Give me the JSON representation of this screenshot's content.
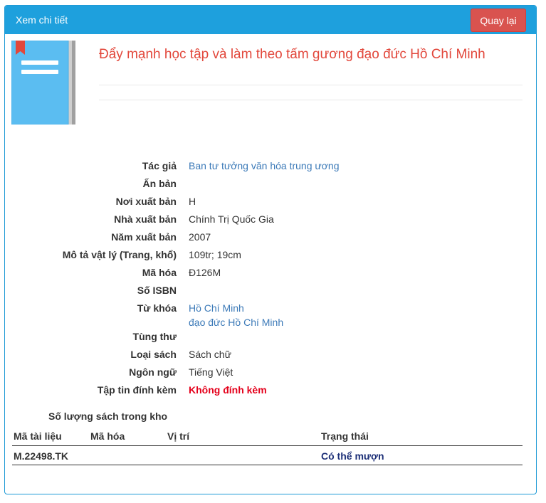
{
  "header": {
    "title": "Xem chi tiết",
    "back_label": "Quay lại"
  },
  "book": {
    "title": "Đẩy mạnh học tập và làm theo tấm gương đạo đức Hồ Chí Minh",
    "fields": {
      "author_label": "Tác giả",
      "author": "Ban tư tưởng văn hóa trung ương",
      "edition_label": "Ấn bản",
      "edition": "",
      "place_label": "Nơi xuất bản",
      "place": "H",
      "publisher_label": "Nhà xuất bản",
      "publisher": "Chính Trị Quốc Gia",
      "year_label": "Năm xuất bản",
      "year": "2007",
      "physical_label": "Mô tả vật lý (Trang, khổ)",
      "physical": "109tr; 19cm",
      "code_label": "Mã hóa",
      "code": "Đ126M",
      "isbn_label": "Số ISBN",
      "isbn": "",
      "keywords_label": "Từ khóa",
      "keywords": [
        "Hồ Chí Minh",
        "đạo đức Hồ Chí Minh"
      ],
      "series_label": "Tùng thư",
      "series": "",
      "type_label": "Loại sách",
      "type": "Sách chữ",
      "language_label": "Ngôn ngữ",
      "language": "Tiếng Việt",
      "attachment_label": "Tập tin đính kèm",
      "attachment": "Không đính kèm"
    }
  },
  "stock": {
    "title": "Số lượng sách trong kho",
    "columns": [
      "Mã tài liệu",
      "Mã hóa",
      "Vị trí",
      "Trạng thái"
    ],
    "rows": [
      {
        "doc_id": "M.22498.TK",
        "code": "",
        "location": "",
        "status": "Có thể mượn"
      }
    ]
  },
  "colors": {
    "header": "#1ea0dd",
    "back_button": "#d9534f",
    "title": "#e2473b",
    "link": "#3c7ab8",
    "attachment": "#e4001b",
    "status": "#1c2f77"
  },
  "icons": {
    "cover": "book-cover-icon"
  }
}
